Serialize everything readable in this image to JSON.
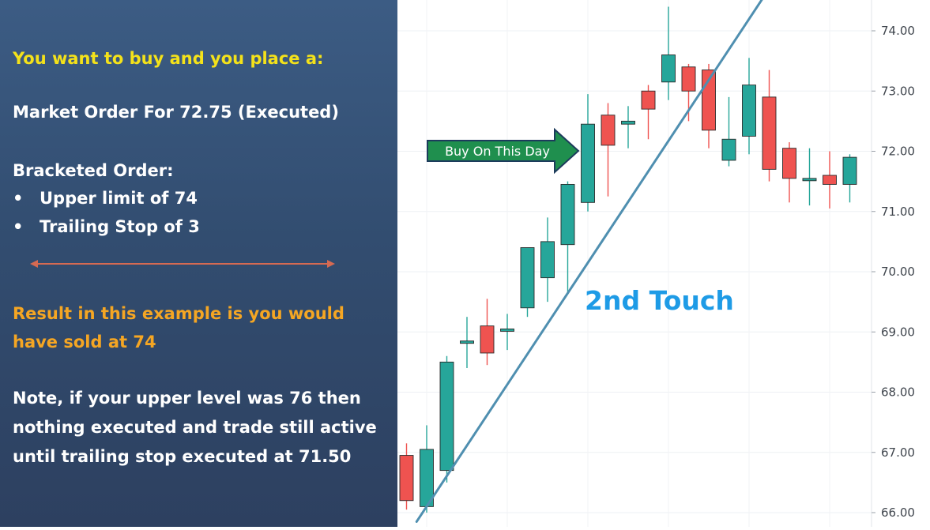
{
  "left_panel": {
    "intro": "You want to buy and you place a:",
    "market_order": "Market Order For 72.75 (Executed)",
    "bracketed_heading": "Bracketed Order:",
    "bullets": [
      "Upper limit of 74",
      "Trailing Stop of 3"
    ],
    "result_line1": "Result in this example is you would",
    "result_line2": "have sold at 74",
    "note": "Note, if your upper level was 76 then nothing executed and trade still active until trailing stop executed at 71.50",
    "colors": {
      "intro": "#f4e21a",
      "result": "#f5a623",
      "divider_arrow": "#d66a52"
    }
  },
  "chart_data": {
    "type": "candlestick",
    "y_ticks": [
      "66.00",
      "67.00",
      "68.00",
      "69.00",
      "70.00",
      "71.00",
      "72.00",
      "73.00",
      "74.00"
    ],
    "ylim": [
      65.95,
      74.65
    ],
    "grid": true,
    "candles": [
      {
        "o": 66.95,
        "h": 67.15,
        "l": 66.05,
        "c": 66.2
      },
      {
        "o": 66.1,
        "h": 67.45,
        "l": 66.0,
        "c": 67.05
      },
      {
        "o": 66.7,
        "h": 68.6,
        "l": 66.5,
        "c": 68.5
      },
      {
        "o": 68.85,
        "h": 69.25,
        "l": 68.4,
        "c": 68.85
      },
      {
        "o": 69.1,
        "h": 69.55,
        "l": 68.45,
        "c": 68.65
      },
      {
        "o": 69.05,
        "h": 69.3,
        "l": 68.7,
        "c": 69.05
      },
      {
        "o": 69.4,
        "h": 70.4,
        "l": 69.25,
        "c": 70.4
      },
      {
        "o": 69.9,
        "h": 70.9,
        "l": 69.5,
        "c": 70.5
      },
      {
        "o": 70.45,
        "h": 71.5,
        "l": 69.65,
        "c": 71.45
      },
      {
        "o": 71.15,
        "h": 72.95,
        "l": 71.0,
        "c": 72.45
      },
      {
        "o": 72.6,
        "h": 72.8,
        "l": 71.25,
        "c": 72.1
      },
      {
        "o": 72.45,
        "h": 72.75,
        "l": 72.05,
        "c": 72.5
      },
      {
        "o": 73.0,
        "h": 73.1,
        "l": 72.2,
        "c": 72.7
      },
      {
        "o": 73.15,
        "h": 74.4,
        "l": 72.85,
        "c": 73.6
      },
      {
        "o": 73.4,
        "h": 73.45,
        "l": 72.5,
        "c": 73.0
      },
      {
        "o": 73.35,
        "h": 73.45,
        "l": 72.05,
        "c": 72.35
      },
      {
        "o": 71.85,
        "h": 72.9,
        "l": 71.75,
        "c": 72.2
      },
      {
        "o": 72.25,
        "h": 73.55,
        "l": 71.95,
        "c": 73.1
      },
      {
        "o": 72.9,
        "h": 73.35,
        "l": 71.5,
        "c": 71.7
      },
      {
        "o": 72.05,
        "h": 72.15,
        "l": 71.15,
        "c": 71.55
      },
      {
        "o": 71.55,
        "h": 72.05,
        "l": 71.1,
        "c": 71.55
      },
      {
        "o": 71.6,
        "h": 72.0,
        "l": 71.05,
        "c": 71.45
      },
      {
        "o": 71.45,
        "h": 71.95,
        "l": 71.15,
        "c": 71.9
      }
    ],
    "up_color": "#26a69a",
    "down_color": "#ef5350",
    "trendline": {
      "from": [
        0.5,
        65.85
      ],
      "to": [
        17.7,
        74.55
      ],
      "color": "#4f8fb0"
    },
    "buy_marker": {
      "label": "Buy On This Day",
      "candle_index": 9,
      "color": "#1f8f4e"
    },
    "annotation": {
      "text": "2nd Touch",
      "color": "#1e9be6"
    }
  }
}
